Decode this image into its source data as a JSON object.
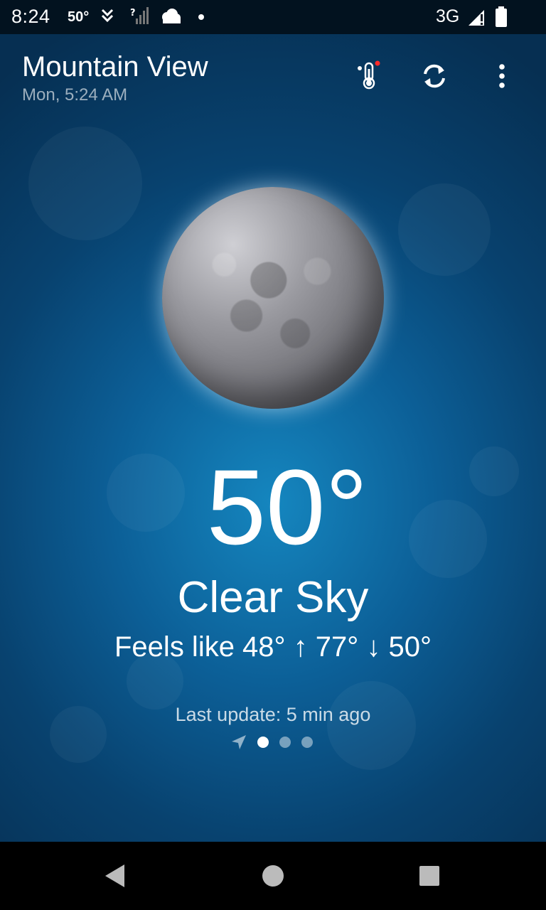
{
  "status_bar": {
    "time": "8:24",
    "temp": "50°",
    "network": "3G"
  },
  "header": {
    "city": "Mountain View",
    "date": "Mon, 5:24 AM"
  },
  "weather": {
    "temperature": "50°",
    "condition": "Clear Sky",
    "feels_like": "Feels like 48° ↑ 77° ↓ 50°",
    "last_update": "Last update: 5 min ago"
  },
  "pager": {
    "pages": 3,
    "active_index": 0
  },
  "icons": {
    "thermometer": "thermometer-icon",
    "refresh": "refresh-icon",
    "menu": "more-vert-icon",
    "location": "location-arrow-icon"
  },
  "colors": {
    "alert_dot": "#ff2a2a",
    "background_dark": "#062f52",
    "background_light": "#1586bf"
  }
}
